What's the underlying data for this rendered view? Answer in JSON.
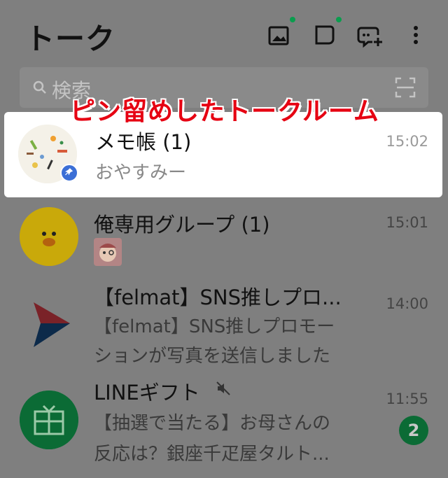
{
  "header": {
    "title": "トーク",
    "icons": [
      "photo-icon",
      "chat-bubble-icon",
      "new-chat-icon",
      "more-vert-icon"
    ],
    "accent_dot_color": "#0a9d4e"
  },
  "search": {
    "placeholder": "検索",
    "scan_icon": "scan-icon"
  },
  "annotation": {
    "text": "ピン留めしたトークルーム",
    "color": "#e60012"
  },
  "chats": [
    {
      "name": "メモ帳 (1)",
      "preview": "おやすみー",
      "time": "15:02",
      "pinned": true,
      "pin_icon": "pin-icon"
    },
    {
      "name": "俺専用グループ (1)",
      "preview": "",
      "preview_icon": "sticker-icon",
      "time": "15:01"
    },
    {
      "name": "【felmat】SNS推しプロ...",
      "preview_line1": "【felmat】SNS推しプロモー",
      "preview_line2": "ションが写真を送信しました",
      "time": "14:00"
    },
    {
      "name": "LINEギフト",
      "muted_icon": "mute-icon",
      "preview_line1": "【抽選で当たる】お母さんの",
      "preview_line2": "反応は？銀座千疋屋タルト...",
      "time": "11:55",
      "unread": "2"
    }
  ]
}
